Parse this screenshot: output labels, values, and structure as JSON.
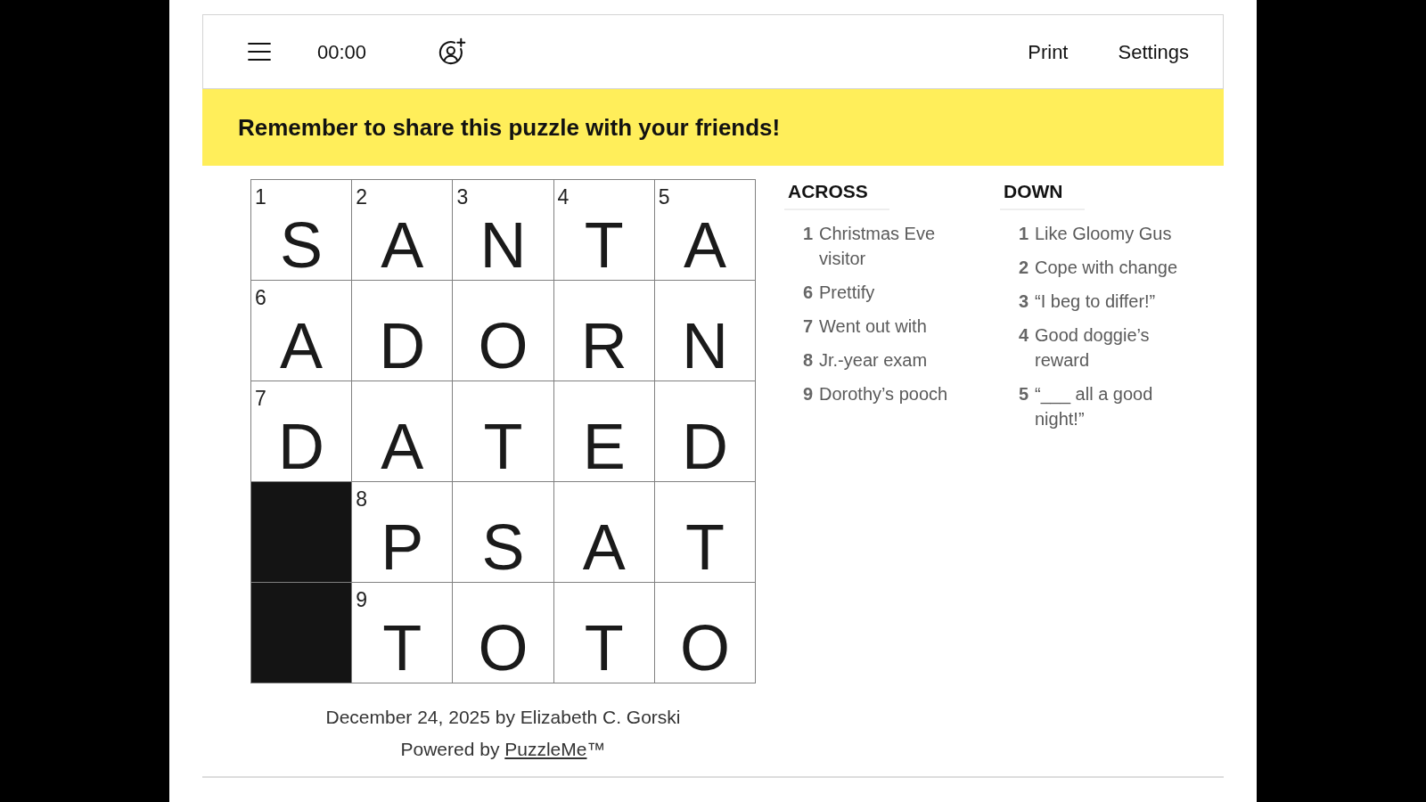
{
  "toolbar": {
    "timer": "00:00",
    "actions": [
      "Print",
      "Settings"
    ]
  },
  "banner": "Remember to share this puzzle with your friends!",
  "grid": {
    "rows": [
      [
        {
          "kind": "letter",
          "number": "1",
          "letter": "S"
        },
        {
          "kind": "letter",
          "number": "2",
          "letter": "A"
        },
        {
          "kind": "letter",
          "number": "3",
          "letter": "N"
        },
        {
          "kind": "letter",
          "number": "4",
          "letter": "T"
        },
        {
          "kind": "letter",
          "number": "5",
          "letter": "A"
        }
      ],
      [
        {
          "kind": "letter",
          "number": "6",
          "letter": "A"
        },
        {
          "kind": "letter",
          "letter": "D"
        },
        {
          "kind": "letter",
          "letter": "O"
        },
        {
          "kind": "letter",
          "letter": "R"
        },
        {
          "kind": "letter",
          "letter": "N"
        }
      ],
      [
        {
          "kind": "letter",
          "number": "7",
          "letter": "D"
        },
        {
          "kind": "letter",
          "letter": "A"
        },
        {
          "kind": "letter",
          "letter": "T"
        },
        {
          "kind": "letter",
          "letter": "E"
        },
        {
          "kind": "letter",
          "letter": "D"
        }
      ],
      [
        {
          "kind": "block"
        },
        {
          "kind": "letter",
          "number": "8",
          "letter": "P"
        },
        {
          "kind": "letter",
          "letter": "S"
        },
        {
          "kind": "letter",
          "letter": "A"
        },
        {
          "kind": "letter",
          "letter": "T"
        }
      ],
      [
        {
          "kind": "block"
        },
        {
          "kind": "letter",
          "number": "9",
          "letter": "T"
        },
        {
          "kind": "letter",
          "letter": "O"
        },
        {
          "kind": "letter",
          "letter": "T"
        },
        {
          "kind": "letter",
          "letter": "O"
        }
      ]
    ]
  },
  "clues": [
    {
      "title": "ACROSS",
      "items": [
        {
          "number": "1",
          "text": "Christmas Eve visitor"
        },
        {
          "number": "6",
          "text": "Prettify"
        },
        {
          "number": "7",
          "text": "Went out with"
        },
        {
          "number": "8",
          "text": "Jr.-year exam"
        },
        {
          "number": "9",
          "text": "Dorothy’s pooch"
        }
      ]
    },
    {
      "title": "DOWN",
      "items": [
        {
          "number": "1",
          "text": "Like Gloomy Gus"
        },
        {
          "number": "2",
          "text": "Cope with change"
        },
        {
          "number": "3",
          "text": "“I beg to differ!”"
        },
        {
          "number": "4",
          "text": "Good doggie’s reward"
        },
        {
          "number": "5",
          "text": "“___ all a good night!”"
        }
      ]
    }
  ],
  "footer": {
    "byline": "December 24, 2025 by Elizabeth C. Gorski",
    "powered_by": "Powered by",
    "link": "PuzzleMe",
    "trademark": "™"
  }
}
